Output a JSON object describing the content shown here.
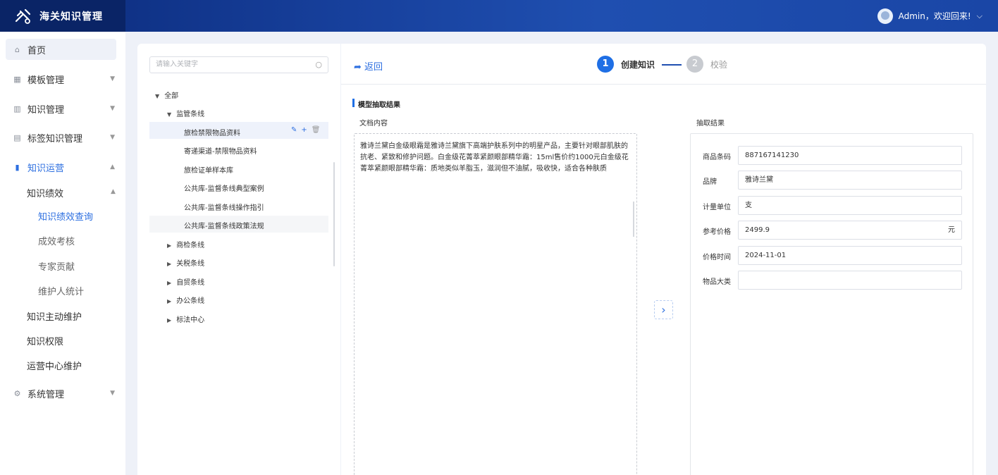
{
  "app": {
    "title": "海关知识管理",
    "user_greeting": "Admin，欢迎回来!"
  },
  "sidebar": {
    "items": [
      {
        "label": "首页"
      },
      {
        "label": "模板管理"
      },
      {
        "label": "知识管理"
      },
      {
        "label": "标签知识管理"
      },
      {
        "label": "知识运营"
      },
      {
        "label": "系统管理"
      }
    ],
    "sub": {
      "perf": "知识绩效",
      "perf_query": "知识绩效查询",
      "perf_assess": "成效考核",
      "expert": "专家贡献",
      "maintainer": "维护人统计",
      "active_maint": "知识主动维护",
      "perm": "知识权限",
      "ops_center": "运营中心维护"
    }
  },
  "tree": {
    "search_placeholder": "请输入关键字",
    "root": "全部",
    "group1": "监管条线",
    "children": [
      "旅检禁限物品资料",
      "寄递渠道-禁限物品资料",
      "旅检证单样本库",
      "公共库-监督条线典型案例",
      "公共库-监督条线操作指引",
      "公共库-监督条线政策法规"
    ],
    "others": [
      "商检条线",
      "关税条线",
      "自贸条线",
      "办公条线",
      "标法中心"
    ]
  },
  "main": {
    "back": "返回",
    "steps": [
      {
        "num": "1",
        "label": "创建知识"
      },
      {
        "num": "2",
        "label": "校验"
      }
    ],
    "section_title": "模型抽取结果",
    "doc_label": "文档内容",
    "result_label": "抽取结果",
    "doc_text": "雅诗兰黛白金级眼霜是雅诗兰黛旗下高端护肤系列中的明星产品，主要针对眼部肌肤的抗老、紧致和修护问题。白金级花菁萃紧颜眼部精华霜：15ml售价约1000元白金级花菁萃紧颜眼部精华霜：质地类似羊脂玉，滋润但不油腻，吸收快，适合各种肤质",
    "fields": [
      {
        "label": "商品条码",
        "value": "887167141230",
        "unit": ""
      },
      {
        "label": "品牌",
        "value": "雅诗兰黛",
        "unit": ""
      },
      {
        "label": "计量单位",
        "value": "支",
        "unit": ""
      },
      {
        "label": "参考价格",
        "value": "2499.9",
        "unit": "元"
      },
      {
        "label": "价格时间",
        "value": "2024-11-01",
        "unit": ""
      },
      {
        "label": "物品大类",
        "value": "",
        "unit": ""
      }
    ]
  }
}
